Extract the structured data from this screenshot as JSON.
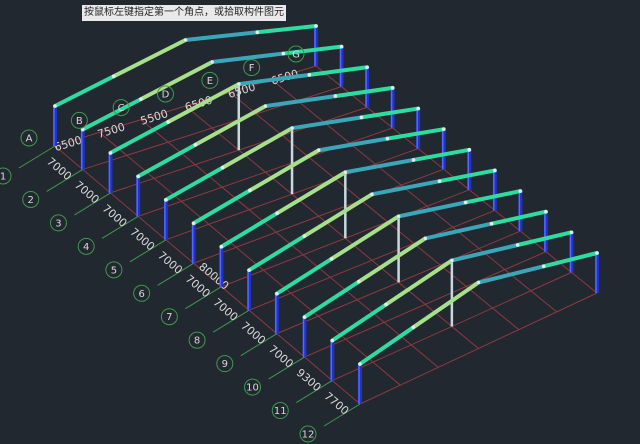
{
  "prompt": "按鼠标左键指定第一个角点，或拾取构件图元",
  "row_axes": [
    "1",
    "2",
    "3",
    "4",
    "5",
    "6",
    "7",
    "8",
    "9",
    "10",
    "11",
    "12"
  ],
  "row_spacings": [
    "7000",
    "7000",
    "7000",
    "7000",
    "7000",
    "7000",
    "7000",
    "7000",
    "7000",
    "9300",
    "7700"
  ],
  "frame_total_label": "80000",
  "col_axes": [
    "A",
    "B",
    "C",
    "D",
    "E",
    "F",
    "G"
  ],
  "col_spacings": [
    "6500",
    "7500",
    "5500",
    "6500",
    "6500",
    "6500"
  ],
  "colors": {
    "background": "#212830",
    "grid": "#8e3a3d",
    "dimension": "#3f9a4b",
    "column": "#1e33c8",
    "rafter_outer": "#2fdca0",
    "rafter_mid": "#a6e08a",
    "rafter_ridge": "#3aa6b8",
    "wind_column": "#c8d8e0"
  }
}
